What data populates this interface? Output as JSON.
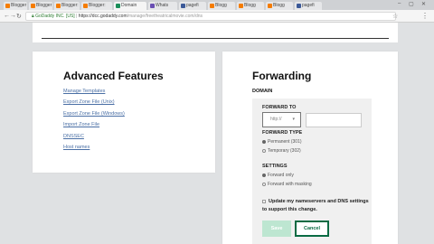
{
  "browser": {
    "tabs": [
      {
        "label": "Blogger",
        "color": "#f57c00"
      },
      {
        "label": "Blogger",
        "color": "#f57c00"
      },
      {
        "label": "Blogger:",
        "color": "#f57c00"
      },
      {
        "label": "Blogger:",
        "color": "#f57c00"
      },
      {
        "label": "Domain",
        "color": "#1b8e5a"
      },
      {
        "label": "Whats",
        "color": "#6a4fb3"
      },
      {
        "label": "pagefi",
        "color": "#3b5998"
      },
      {
        "label": "Blogg",
        "color": "#f57c00"
      },
      {
        "label": "Blogg",
        "color": "#f57c00"
      },
      {
        "label": "Blogg",
        "color": "#f57c00"
      },
      {
        "label": "pagefi",
        "color": "#3b5998"
      }
    ],
    "window_controls": {
      "minimize": "–",
      "maximize": "▢",
      "close": "✕"
    },
    "address": {
      "org": "GoDaddy INC. [US]",
      "host": "https://dcc.godaddy.com",
      "path": "/manage/freetheatricalmovie.com/dns"
    }
  },
  "advanced": {
    "title": "Advanced Features",
    "links": [
      "Manage Templates",
      "Export Zone File (Unix)",
      "Export Zone File (Windows)",
      "Import Zone File",
      "DNSSEC",
      "Host names"
    ]
  },
  "forwarding": {
    "title": "Forwarding",
    "domain_label": "DOMAIN",
    "forward_to_label": "FORWARD TO",
    "protocol_value": "http://",
    "forward_type_label": "FORWARD TYPE",
    "forward_type_options": [
      "Permanent (301)",
      "Temporary (302)"
    ],
    "forward_type_selected": 0,
    "settings_label": "SETTINGS",
    "settings_options": [
      "Forward only",
      "Forward with masking"
    ],
    "settings_selected": 0,
    "update_ns_text": "Update my nameservers and DNS settings to support this change.",
    "save_label": "Save",
    "cancel_label": "Cancel"
  },
  "colors": {
    "accent": "#0a6b43",
    "save_disabled": "#bde6d1",
    "link": "#4a6fa5"
  }
}
